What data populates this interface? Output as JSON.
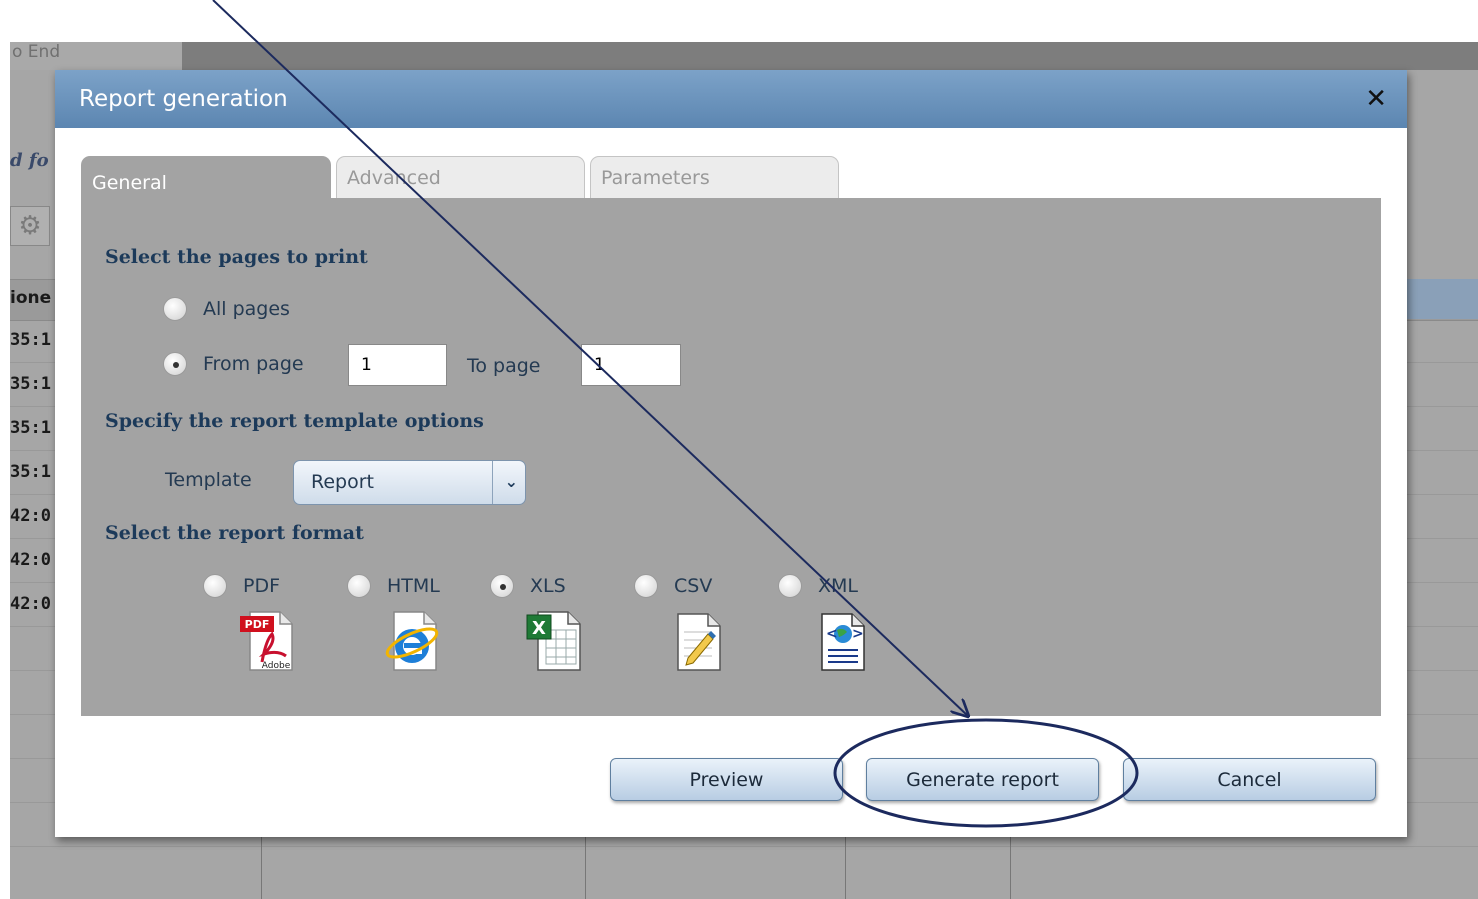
{
  "background": {
    "tab_end": "o End",
    "italic_text": "d fo",
    "col_header": "ione",
    "cells": [
      "35:1",
      "35:1",
      "35:1",
      "35:1",
      "42:0",
      "42:0",
      "42:0"
    ]
  },
  "dialog": {
    "title": "Report generation",
    "close_glyph": "✕"
  },
  "tabs": [
    {
      "label": "General"
    },
    {
      "label": "Advanced"
    },
    {
      "label": "Parameters"
    }
  ],
  "general": {
    "pages_heading": "Select the pages to print",
    "all_pages_label": "All pages",
    "from_page_label": "From page",
    "from_page_value": "1",
    "to_page_label": "To page",
    "to_page_value": "1",
    "selected_page_option": "from_page",
    "template_heading": "Specify the report template options",
    "template_label": "Template",
    "template_value": "Report",
    "format_heading": "Select the report format",
    "formats": [
      {
        "label": "PDF",
        "icon": "pdf-icon"
      },
      {
        "label": "HTML",
        "icon": "internet-explorer-icon"
      },
      {
        "label": "XLS",
        "icon": "excel-icon"
      },
      {
        "label": "CSV",
        "icon": "csv-document-icon"
      },
      {
        "label": "XML",
        "icon": "xml-document-icon"
      }
    ],
    "selected_format": "XLS"
  },
  "buttons": {
    "preview": "Preview",
    "generate": "Generate report",
    "cancel": "Cancel"
  },
  "annotation": {
    "arrow_color": "#1c2a5e",
    "circle_color": "#1c2a5e"
  }
}
